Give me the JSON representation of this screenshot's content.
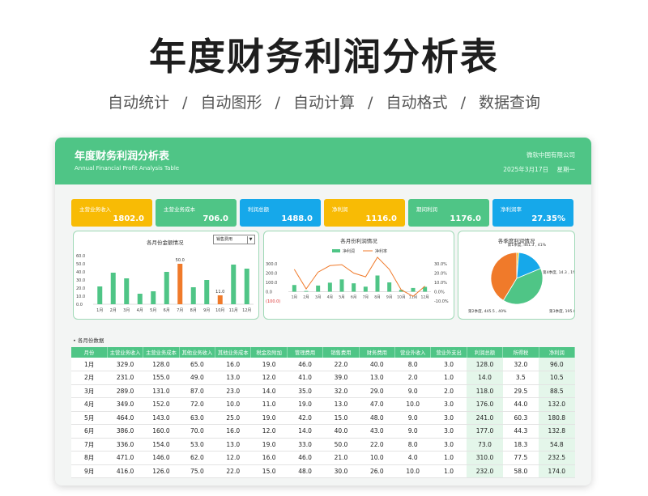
{
  "hero": {
    "title": "年度财务利润分析表",
    "features": [
      "自动统计",
      "/",
      "自动图形",
      "/",
      "自动计算",
      "/",
      "自动格式",
      "/",
      "数据查询"
    ]
  },
  "banner": {
    "title": "年度财务利润分析表",
    "subtitle": "Annual Financial Profit Analysis Table",
    "company": "微软中国有限公司",
    "date": "2025年3月17日",
    "weekday": "星期一"
  },
  "kpis": [
    {
      "label": "主营业务收入",
      "value": "1802.0",
      "color": "#f8bb05"
    },
    {
      "label": "主营业务成本",
      "value": "706.0",
      "color": "#4fc586"
    },
    {
      "label": "利润总额",
      "value": "1488.0",
      "color": "#16a8ea"
    },
    {
      "label": "净利润",
      "value": "1116.0",
      "color": "#f8bb05"
    },
    {
      "label": "期间利润",
      "value": "1176.0",
      "color": "#4fc586"
    },
    {
      "label": "净利润率",
      "value": "27.35%",
      "color": "#16a8ea"
    }
  ],
  "chart_data": [
    {
      "type": "bar",
      "title": "各月份金额情况",
      "dropdown": "销售费用",
      "categories": [
        "1月",
        "2月",
        "3月",
        "4月",
        "5月",
        "6月",
        "7月",
        "8月",
        "9月",
        "10月",
        "11月",
        "12月"
      ],
      "values": [
        22.0,
        39.0,
        32.0,
        13.0,
        16.0,
        40.0,
        50.0,
        21.0,
        30.0,
        11.0,
        49.0,
        44.0
      ],
      "highlight": [
        {
          "index": 6,
          "label": "50.0"
        },
        {
          "index": 9,
          "label": "11.0"
        }
      ],
      "yticks": [
        "60.0",
        "50.0",
        "40.0",
        "30.0",
        "20.0",
        "10.0",
        "0.0"
      ],
      "ylim": [
        0,
        60
      ],
      "colors": {
        "bar": "#4fc586",
        "highlight": "#f07a2a"
      }
    },
    {
      "type": "line",
      "title": "各月份利润情况",
      "legend": [
        "净利润",
        "净利率"
      ],
      "categories": [
        "1月",
        "2月",
        "3月",
        "4月",
        "5月",
        "6月",
        "7月",
        "8月",
        "9月",
        "10月",
        "11月",
        "12月"
      ],
      "series": [
        {
          "name": "净利润",
          "kind": "bar",
          "values": [
            72,
            8,
            66,
            97,
            132,
            90,
            54,
            174,
            100,
            20,
            40,
            52
          ]
        },
        {
          "name": "净利率",
          "kind": "line",
          "values": [
            24,
            3,
            21,
            28,
            29,
            20,
            16,
            37,
            24,
            2,
            -5,
            6
          ]
        }
      ],
      "yticks_left": [
        "300.0",
        "200.0",
        "100.0",
        "0.0",
        "(100.0)"
      ],
      "yticks_right": [
        "30.0%",
        "20.0%",
        "10.0%",
        "0.0%",
        "-10.0%"
      ],
      "ylim_left": [
        -100,
        300
      ],
      "ylim_right": [
        -10,
        30
      ],
      "colors": {
        "bar": "#4fc586",
        "line": "#f07a2a"
      }
    },
    {
      "type": "pie",
      "title": "各季度利润情况",
      "slices": [
        {
          "label": "第1季度, 461.3 , 41%",
          "value": 461.3,
          "color": "#f07a2a"
        },
        {
          "label": "第4季度, 14.3 , 1%",
          "value": 14.3,
          "color": "#f8bb05"
        },
        {
          "label": "第3季度, 195.0 , 18%",
          "value": 195.0,
          "color": "#16a8ea"
        },
        {
          "label": "第2季度, 445.5 , 40%",
          "value": 445.5,
          "color": "#4fc586"
        }
      ]
    }
  ],
  "table": {
    "section_label": "各月份数据",
    "headers": [
      "月份",
      "主营业务收入",
      "主营业务成本",
      "其他业务收入",
      "其他业务成本",
      "税金及附加",
      "管理费用",
      "销售费用",
      "财务费用",
      "营业外收入",
      "营业外支出",
      "利润总额",
      "所得税",
      "净利润"
    ],
    "rows": [
      [
        "1月",
        "329.0",
        "128.0",
        "65.0",
        "16.0",
        "19.0",
        "46.0",
        "22.0",
        "40.0",
        "8.0",
        "3.0",
        "128.0",
        "32.0",
        "96.0"
      ],
      [
        "2月",
        "231.0",
        "155.0",
        "49.0",
        "13.0",
        "12.0",
        "41.0",
        "39.0",
        "13.0",
        "2.0",
        "1.0",
        "14.0",
        "3.5",
        "10.5"
      ],
      [
        "3月",
        "289.0",
        "131.0",
        "87.0",
        "23.0",
        "14.0",
        "35.0",
        "32.0",
        "29.0",
        "9.0",
        "2.0",
        "118.0",
        "29.5",
        "88.5"
      ],
      [
        "4月",
        "349.0",
        "152.0",
        "72.0",
        "10.0",
        "11.0",
        "19.0",
        "13.0",
        "47.0",
        "10.0",
        "3.0",
        "176.0",
        "44.0",
        "132.0"
      ],
      [
        "5月",
        "464.0",
        "143.0",
        "63.0",
        "25.0",
        "19.0",
        "42.0",
        "15.0",
        "48.0",
        "9.0",
        "3.0",
        "241.0",
        "60.3",
        "180.8"
      ],
      [
        "6月",
        "386.0",
        "160.0",
        "70.0",
        "16.0",
        "12.0",
        "14.0",
        "40.0",
        "43.0",
        "9.0",
        "3.0",
        "177.0",
        "44.3",
        "132.8"
      ],
      [
        "7月",
        "336.0",
        "154.0",
        "53.0",
        "13.0",
        "19.0",
        "33.0",
        "50.0",
        "22.0",
        "8.0",
        "3.0",
        "73.0",
        "18.3",
        "54.8"
      ],
      [
        "8月",
        "471.0",
        "146.0",
        "62.0",
        "12.0",
        "16.0",
        "46.0",
        "21.0",
        "10.0",
        "4.0",
        "1.0",
        "310.0",
        "77.5",
        "232.5"
      ],
      [
        "9月",
        "416.0",
        "126.0",
        "75.0",
        "22.0",
        "15.0",
        "48.0",
        "30.0",
        "26.0",
        "10.0",
        "1.0",
        "232.0",
        "58.0",
        "174.0"
      ]
    ]
  }
}
